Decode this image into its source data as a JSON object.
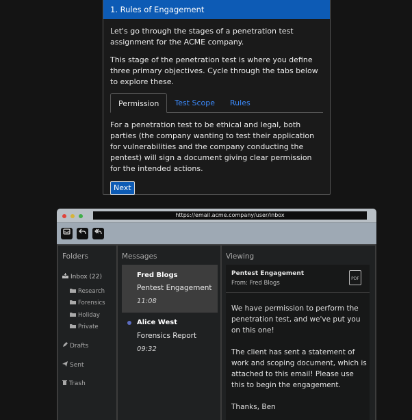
{
  "card": {
    "title": "1. Rules of Engagement",
    "intro": "Let's go through the stages of a penetration test assignment for the ACME company.",
    "stage": "This stage of the penetration test is where you define three primary objectives. Cycle through the tabs below to explore these.",
    "tabs": [
      "Permission",
      "Test Scope",
      "Rules"
    ],
    "active_tab": "Permission",
    "tab_content": "For a penetration test to be ethical and legal, both parties (the company wanting to test their application for vulnerabilities and the company conducting the pentest) will sign a document giving clear permission for the intended actions.",
    "next_label": "Next"
  },
  "browser": {
    "url": "https://email.acme.company/user/inbox"
  },
  "email": {
    "folders_title": "Folders",
    "inbox_label": "Inbox (22)",
    "subfolders": [
      "Research",
      "Forensics",
      "Holiday",
      "Private"
    ],
    "drafts": "Drafts",
    "sent": "Sent",
    "trash": "Trash",
    "messages_title": "Messages",
    "messages": [
      {
        "from": "Fred Blogs",
        "subject": "Pentest Engagement",
        "time": "11:08"
      },
      {
        "from": "Alice West",
        "subject": "Forensics Report",
        "time": "09:32"
      }
    ],
    "viewing_title": "Viewing",
    "viewing": {
      "subject": "Pentest Engagement",
      "from": "From: Fred Blogs",
      "attachment_label": "PDF",
      "body": [
        "We have permission to perform the penetration test, and we've put you on this one!",
        "The client has sent a statement of work and scoping document, which is attached to this email! Please use this to begin the engagement.",
        "Thanks, Ben"
      ]
    }
  },
  "colors": {
    "accent": "#0d5bb5",
    "link": "#3c8cff",
    "unread_dot": "#5c6cc0"
  }
}
